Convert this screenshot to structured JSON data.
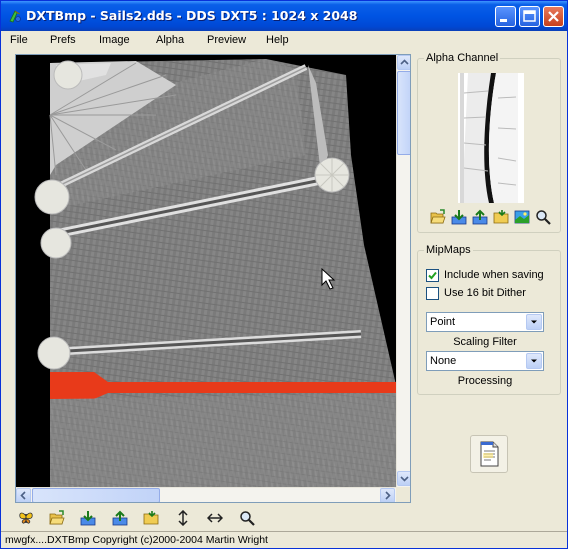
{
  "window": {
    "title": "DXTBmp - Sails2.dds - DDS DXT5 : 1024 x 2048",
    "app_icon": "dxtbmp-app-icon",
    "controls": [
      "minimize-icon",
      "maximize-icon",
      "close-icon"
    ]
  },
  "menu": [
    "File",
    "Prefs",
    "Image",
    "Alpha",
    "Preview",
    "Help"
  ],
  "alpha_channel": {
    "title": "Alpha Channel",
    "tools": [
      "open-folder-icon",
      "import-icon",
      "export-icon",
      "folder-icon",
      "edit-image-icon",
      "zoom-icon"
    ]
  },
  "mipmaps": {
    "title": "MipMaps",
    "include_when_saving": {
      "label": "Include when saving",
      "checked": true
    },
    "use_16bit_dither": {
      "label": "Use 16 bit Dither",
      "checked": false
    },
    "scaling_filter": {
      "value": "Point",
      "caption": "Scaling Filter"
    },
    "processing": {
      "value": "None",
      "caption": "Processing"
    }
  },
  "help_icon": "notepad-document-icon",
  "toolbar": [
    "butterfly-icon",
    "open-folder-icon",
    "import-icon",
    "export-icon",
    "folder-icon",
    "flip-vertical-icon",
    "flip-horizontal-icon",
    "zoom-icon"
  ],
  "status": "mwgfx....DXTBmp Copyright (c)2000-2004 Martin Wright",
  "colors": {
    "title_bar": "#0054e3",
    "window_face": "#ece9d8",
    "sail_stripe": "#e83a1a"
  }
}
